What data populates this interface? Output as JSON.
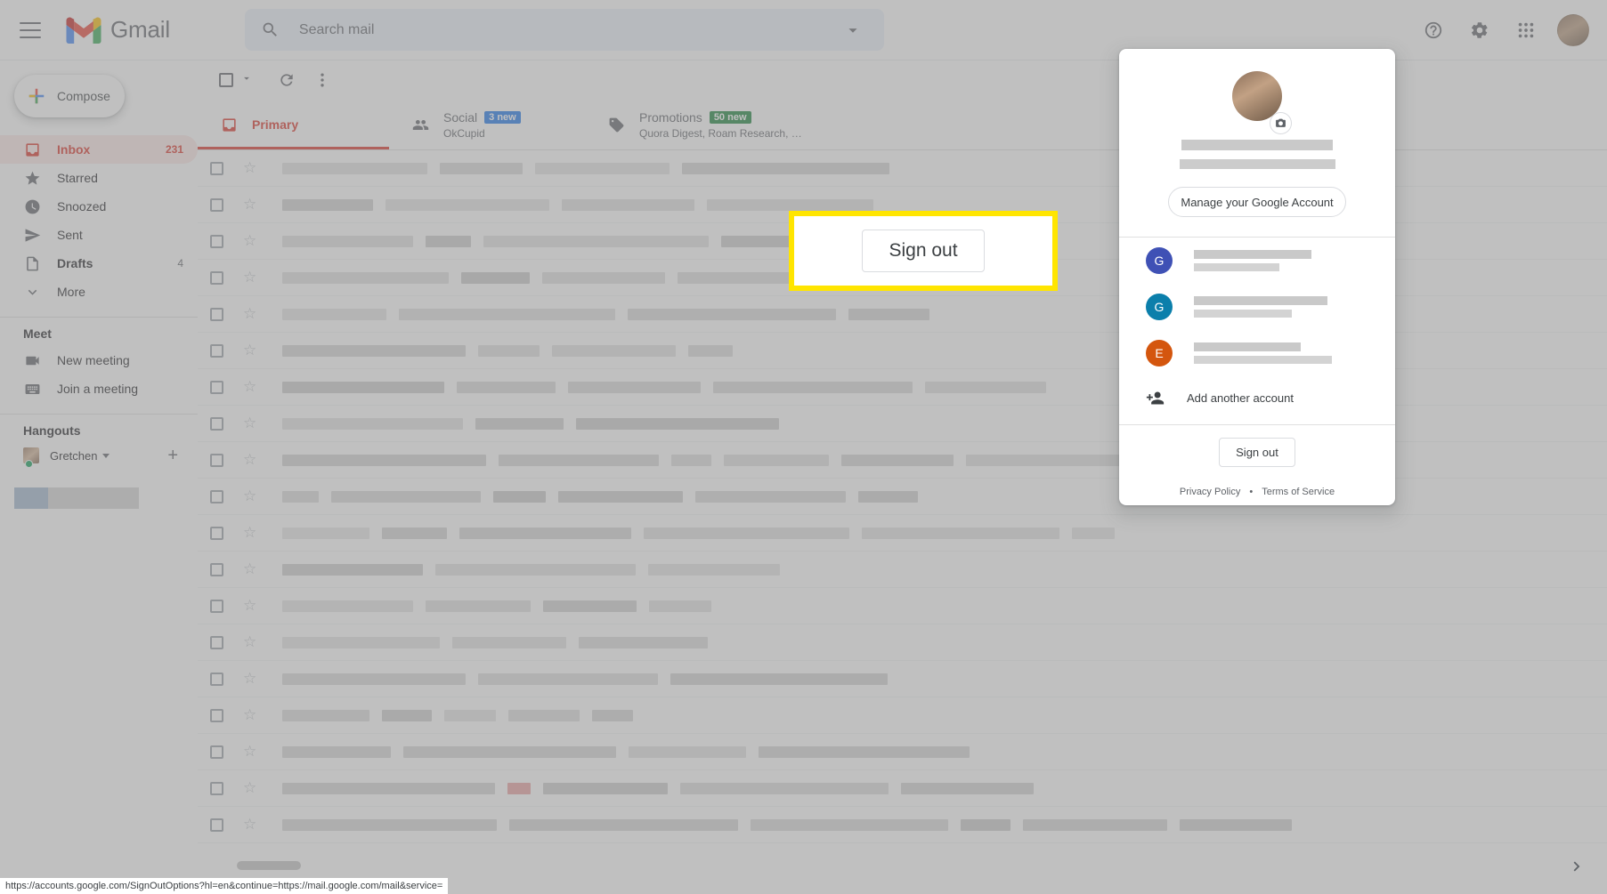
{
  "topbar": {
    "menu_icon": "hamburger-icon",
    "product_name": "Gmail",
    "search_placeholder": "Search mail",
    "search_value": "",
    "search_icon": "search-icon",
    "filter_icon": "chevron-down-icon",
    "help_icon": "help-icon",
    "settings_icon": "gear-icon",
    "apps_icon": "apps-grid-icon",
    "avatar": "account-avatar"
  },
  "sidebar": {
    "compose_label": "Compose",
    "compose_icon": "plus-icon",
    "items": [
      {
        "label": "Inbox",
        "count": "231",
        "icon": "inbox-icon",
        "active": true
      },
      {
        "label": "Starred",
        "count": "",
        "icon": "star-icon",
        "active": false
      },
      {
        "label": "Snoozed",
        "count": "",
        "icon": "clock-icon",
        "active": false
      },
      {
        "label": "Sent",
        "count": "",
        "icon": "send-icon",
        "active": false
      },
      {
        "label": "Drafts",
        "count": "4",
        "icon": "draft-icon",
        "active": false
      },
      {
        "label": "More",
        "count": "",
        "icon": "chevron-down-icon",
        "active": false
      }
    ],
    "meet": {
      "title": "Meet",
      "items": [
        {
          "label": "New meeting",
          "icon": "video-camera-icon"
        },
        {
          "label": "Join a meeting",
          "icon": "keyboard-icon"
        }
      ]
    },
    "hangouts": {
      "title": "Hangouts",
      "contact_name": "Gretchen",
      "status": "online",
      "add_icon": "plus-icon",
      "caret_icon": "caret-down-icon"
    }
  },
  "toolbar": {
    "select_all_icon": "checkbox-icon",
    "select_caret_icon": "caret-down-icon",
    "refresh_icon": "refresh-icon",
    "more_icon": "more-vertical-icon"
  },
  "tabs": [
    {
      "label": "Primary",
      "icon": "inbox-tab-icon",
      "badge": "",
      "subtitle": "",
      "active": true
    },
    {
      "label": "Social",
      "icon": "people-icon",
      "badge": "3 new",
      "badge_color": "#1a73e8",
      "subtitle": "OkCupid",
      "active": false
    },
    {
      "label": "Promotions",
      "icon": "tag-icon",
      "badge": "50 new",
      "badge_color": "#188038",
      "subtitle": "Quora Digest, Roam Research, …",
      "active": false
    }
  ],
  "account_panel": {
    "camera_icon": "camera-icon",
    "manage_account_label": "Manage your Google Account",
    "accounts": [
      {
        "initial": "G",
        "color": "#3f51b5"
      },
      {
        "initial": "G",
        "color": "#0b7fab"
      },
      {
        "initial": "E",
        "color": "#d4560e"
      }
    ],
    "add_account_label": "Add another account",
    "add_account_icon": "person-add-icon",
    "sign_out_label": "Sign out",
    "footer": {
      "privacy": "Privacy Policy",
      "separator": "•",
      "terms": "Terms of Service"
    }
  },
  "callout": {
    "label": "Sign out",
    "highlight_color": "#ffe500"
  },
  "statusbar": {
    "url": "https://accounts.google.com/SignOutOptions?hl=en&continue=https://mail.google.com/mail&service="
  },
  "pagination": {
    "next_icon": "chevron-right-icon"
  }
}
